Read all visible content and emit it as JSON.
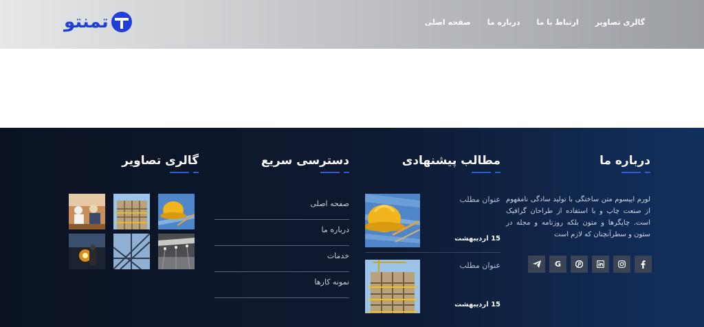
{
  "header": {
    "logo_text": "تمنتو",
    "nav": [
      "صفحه اصلی",
      "درباره ما",
      "ارتباط با ما",
      "گالری تصاویر"
    ]
  },
  "footer": {
    "about": {
      "title": "درباره ما",
      "text": "لورم ایپسوم متن ساختگی با تولید سادگی نامفهوم از صنعت چاپ و با استفاده از طراحان گرافیک است. چاپگرها و متون بلکه روزنامه و مجله در ستون و سطرآنچنان که لازم است",
      "socials": [
        "facebook-icon",
        "instagram-icon",
        "linkedin-icon",
        "pinterest-icon",
        "google-icon",
        "telegram-icon"
      ]
    },
    "posts": {
      "title": "مطالب پیشنهادی",
      "items": [
        {
          "title": "عنوان مطلب",
          "date": "15 اردیبهشت"
        },
        {
          "title": "عنوان مطلب",
          "date": "15 اردیبهشت"
        }
      ]
    },
    "quick": {
      "title": "دسترسی سریع",
      "items": [
        "صفحه اصلی",
        "درباره ما",
        "خدمات",
        "نمونه کارها"
      ]
    },
    "gallery": {
      "title": "گالری تصاویر"
    }
  },
  "colors": {
    "accent": "#2b5fd9",
    "logo": "#1f3fd6",
    "footer_bg": "#0e1a32"
  }
}
